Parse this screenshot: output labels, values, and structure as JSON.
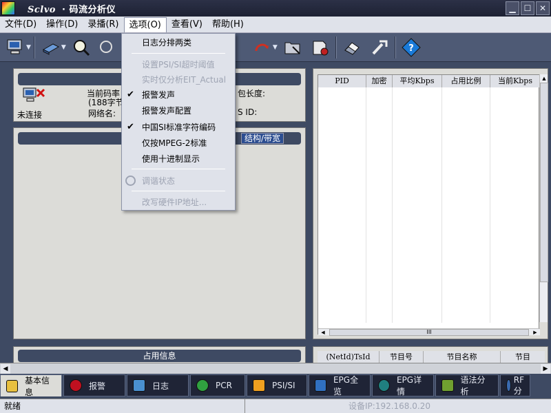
{
  "window": {
    "title_brand": "Sclvo",
    "title_rest": "· 码流分析仪",
    "minimize_glyph": "▁",
    "maximize_glyph": "☐",
    "close_glyph": "✕"
  },
  "menubar": {
    "items": [
      "文件(D)",
      "操作(D)",
      "录播(R)",
      "选项(O)",
      "查看(V)",
      "帮助(H)"
    ]
  },
  "options_menu": {
    "items": [
      {
        "label": "日志分排两类",
        "checked": false,
        "disabled": false
      },
      {
        "label": "设置PSI/SI超时阈值",
        "checked": false,
        "disabled": true
      },
      {
        "label": "实时仅分析EIT_Actual",
        "checked": false,
        "disabled": true
      },
      {
        "label": "报警发声",
        "checked": true,
        "disabled": false
      },
      {
        "label": "报警发声配置",
        "checked": false,
        "disabled": false
      },
      {
        "label": "中国SI标准字符编码",
        "checked": true,
        "disabled": false
      },
      {
        "label": "仅按MPEG-2标准",
        "checked": false,
        "disabled": false
      },
      {
        "label": "使用十进制显示",
        "checked": false,
        "disabled": false
      },
      {
        "label": "调谐状态",
        "checked": false,
        "disabled": true
      },
      {
        "label": "改写硬件IP地址...",
        "checked": false,
        "disabled": true
      }
    ],
    "check_glyph": "✔"
  },
  "left_panel": {
    "connection_status": "未连接",
    "rate_label": "当前码率",
    "rate_detail": "(188字节",
    "network_name_label": "网络名:",
    "pkt_len_label": "包长度:",
    "ts_id_label": "S ID:",
    "structure_tab": "结构/带宽"
  },
  "right_grid": {
    "headers": [
      "PID",
      "加密",
      "平均Kbps",
      "占用比例",
      "当前Kbps"
    ],
    "scroll_thumb": "III"
  },
  "bottom_left": {
    "title": "占用信息"
  },
  "bottom_right": {
    "headers": [
      "(NetId)TsId",
      "节目号",
      "节目名称",
      "节目"
    ]
  },
  "tabs": [
    {
      "label": "基本信息",
      "icon": "home-icon",
      "color": "#e8c040"
    },
    {
      "label": "报警",
      "icon": "alarm-icon",
      "color": "#c01020"
    },
    {
      "label": "日志",
      "icon": "log-icon",
      "color": "#4a90d0"
    },
    {
      "label": "PCR",
      "icon": "clock-icon",
      "color": "#30a040"
    },
    {
      "label": "PSI/SI",
      "icon": "table-icon",
      "color": "#f0a020"
    },
    {
      "label": "EPG全览",
      "icon": "epg-overview-icon",
      "color": "#3070c0"
    },
    {
      "label": "EPG详情",
      "icon": "epg-detail-icon",
      "color": "#208080"
    },
    {
      "label": "语法分析",
      "icon": "syntax-icon",
      "color": "#70a030"
    },
    {
      "label": "RF分",
      "icon": "rf-icon",
      "color": "#3a6ab0"
    }
  ],
  "statusbar": {
    "left": "就绪",
    "right": "设备IP:192.168.0.20"
  }
}
